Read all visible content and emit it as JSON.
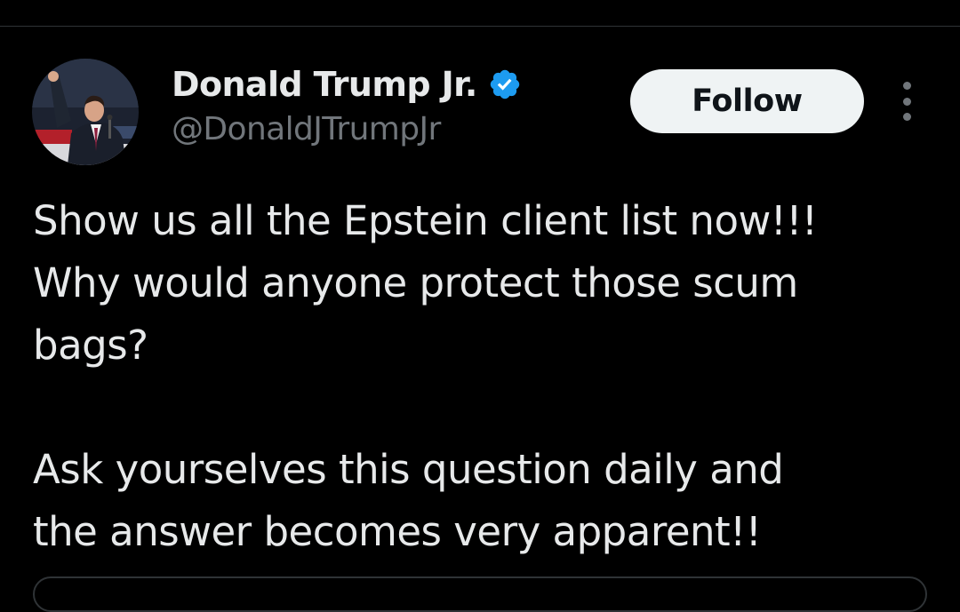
{
  "author": {
    "display_name": "Donald Trump Jr.",
    "handle": "@DonaldJTrumpJr",
    "verified": true,
    "avatar_icon": "profile-photo"
  },
  "actions": {
    "follow_label": "Follow",
    "more_icon": "vertical-ellipsis-icon"
  },
  "tweet": {
    "lines": [
      "Show us all the Epstein client list now!!!",
      "Why would anyone protect those scum",
      "bags?",
      "",
      "Ask yourselves this question daily and",
      "the answer becomes very apparent!!"
    ]
  },
  "colors": {
    "background": "#000000",
    "text_primary": "#e7e9ea",
    "text_secondary": "#71767b",
    "verified_blue": "#1d9bf0",
    "follow_button_bg": "#eff3f4",
    "follow_button_text": "#0f1419",
    "divider": "#2f3336"
  }
}
